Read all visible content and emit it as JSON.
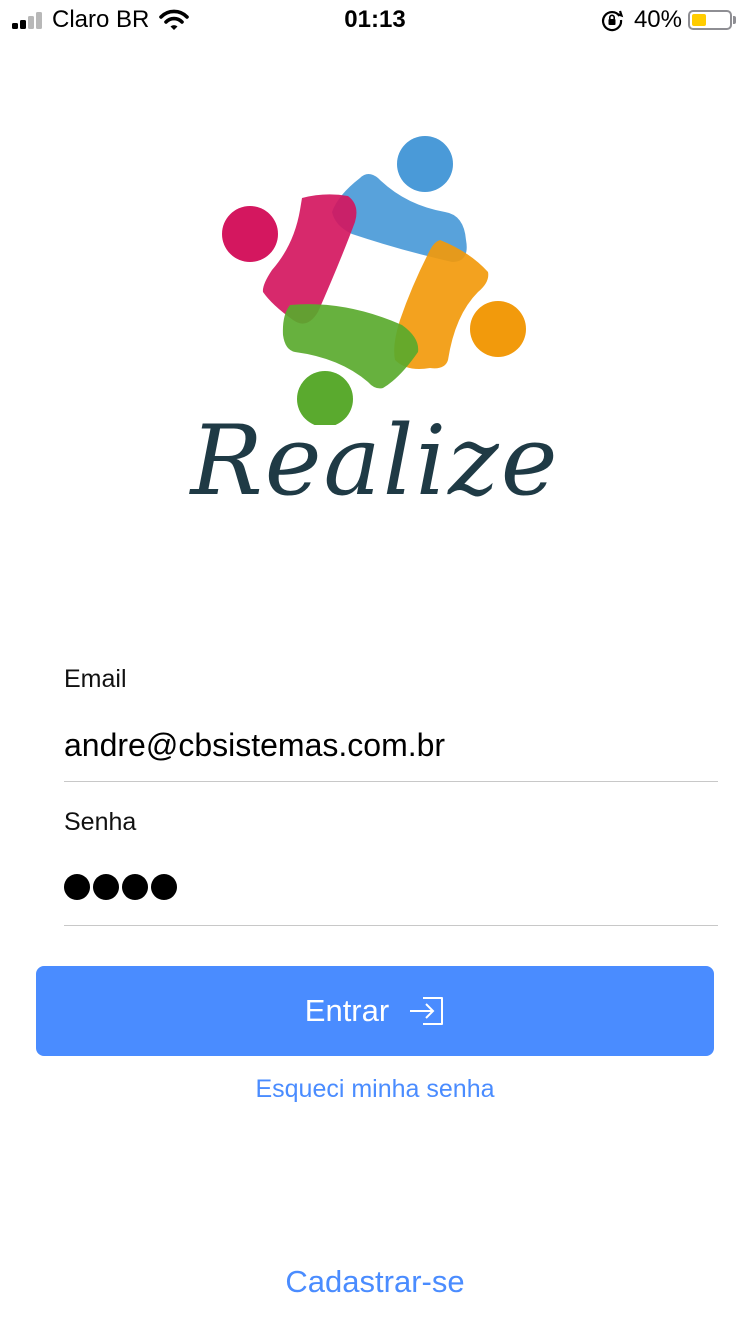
{
  "status_bar": {
    "carrier": "Claro BR",
    "time": "01:13",
    "battery_percent": "40%",
    "battery_level": 0.4,
    "icons": [
      "signal-icon",
      "wifi-icon",
      "orientation-lock-icon",
      "battery-icon"
    ]
  },
  "logo": {
    "wordmark": "Realize",
    "colors": {
      "blue": "#4a9ad8",
      "magenta": "#d4175f",
      "green": "#5aaa2e",
      "orange": "#f29a0c",
      "text": "#1f3a45"
    }
  },
  "form": {
    "email": {
      "label": "Email",
      "value": "andre@cbsistemas.com.br"
    },
    "password": {
      "label": "Senha",
      "masked_length": 4
    }
  },
  "actions": {
    "login_label": "Entrar",
    "forgot_label": "Esqueci minha senha",
    "register_label": "Cadastrar-se"
  },
  "colors": {
    "accent": "#4a8cff",
    "divider": "#c8c8c8"
  }
}
